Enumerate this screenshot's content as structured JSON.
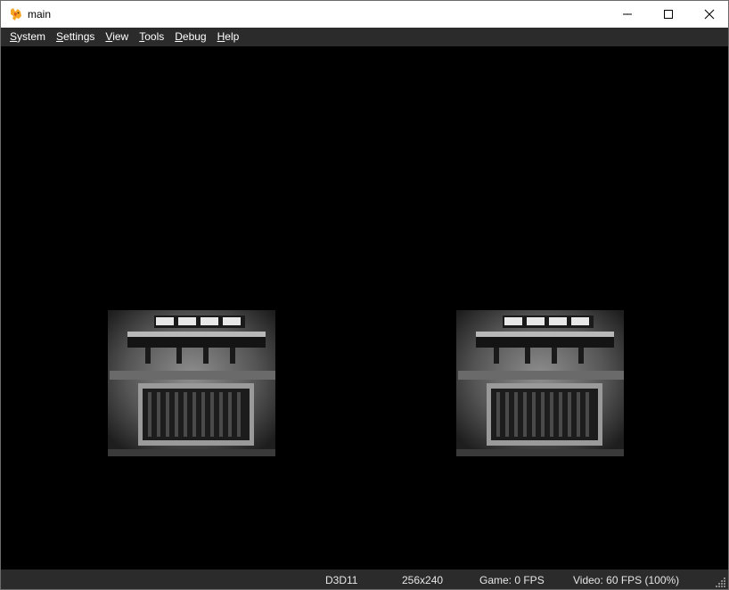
{
  "window": {
    "title": "main",
    "icon": "fox-app-icon",
    "controls": {
      "minimize": "minimize-icon",
      "maximize": "maximize-icon",
      "close": "close-icon"
    }
  },
  "menu": {
    "items": [
      {
        "accel": "S",
        "rest": "ystem"
      },
      {
        "accel": "S",
        "rest": "ettings"
      },
      {
        "accel": "V",
        "rest": "iew"
      },
      {
        "accel": "T",
        "rest": "ools"
      },
      {
        "accel": "D",
        "rest": "ebug"
      },
      {
        "accel": "H",
        "rest": "elp"
      }
    ]
  },
  "statusbar": {
    "renderer": "D3D11",
    "resolution": "256x240",
    "game_fps": "Game: 0 FPS",
    "video_fps": "Video: 60 FPS (100%)"
  },
  "colors": {
    "titlebar_bg": "#ffffff",
    "menubar_bg": "#2b2b2b",
    "viewport_bg": "#000000",
    "statusbar_bg": "#2b2b2b",
    "sprite_metal": "#8a8a8a",
    "app_icon": "#f5a623"
  }
}
